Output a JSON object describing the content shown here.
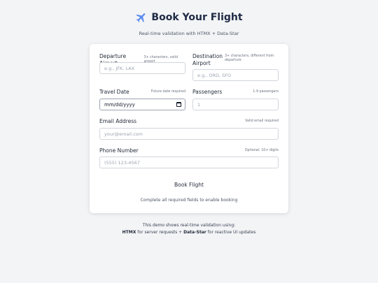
{
  "header": {
    "title": "Book Your Flight",
    "subtitle": "Real-time validation with HTMX + Data-Star"
  },
  "form": {
    "departure": {
      "label": "Departure Airport",
      "hint": "3+ characters, valid airport",
      "placeholder": "e.g., JFK, LAX"
    },
    "destination": {
      "label_line1": "Destination",
      "label_line2": "Airport",
      "hint": "3+ characters, different from departure",
      "placeholder": "e.g., ORD, SFO"
    },
    "travel_date": {
      "label": "Travel Date",
      "hint": "Future date required",
      "value": "mm/dd/yyyy"
    },
    "passengers": {
      "label": "Passengers",
      "hint": "1-9 passengers",
      "value": "1"
    },
    "email": {
      "label": "Email Address",
      "hint": "Valid email required",
      "placeholder": "your@email.com"
    },
    "phone": {
      "label": "Phone Number",
      "hint": "Optional: 10+ digits",
      "placeholder": "(555) 123-4567"
    },
    "book_label": "Book Flight",
    "status": "Complete all required fields to enable booking"
  },
  "footer": {
    "line1": "This demo shows real-time validation using:",
    "htmx": "HTMX",
    "htmx_text": " for server requests + ",
    "datastar": "Data-Star",
    "datastar_text": " for reactive UI updates"
  },
  "icons": {
    "header": "airplane-icon",
    "date": "calendar-icon"
  },
  "colors": {
    "accent_icon": "#3b82f6",
    "title": "#1f2a44",
    "background": "#f3f4f6"
  }
}
